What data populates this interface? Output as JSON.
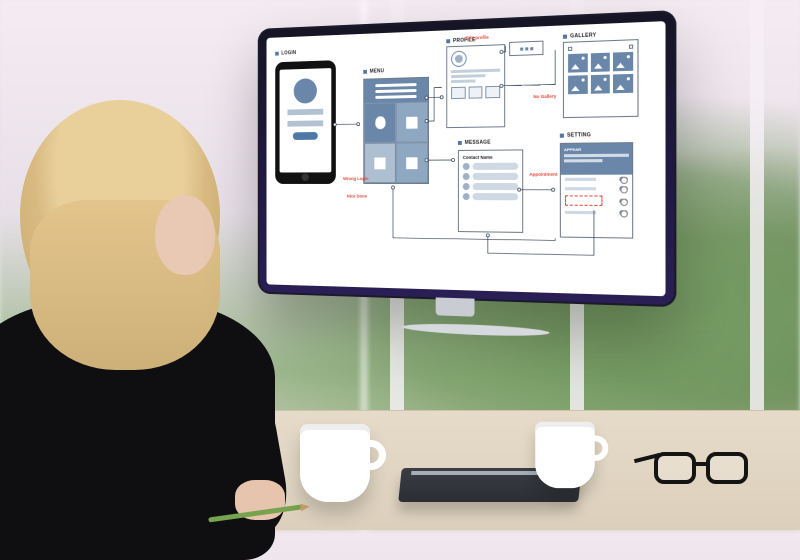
{
  "frames": {
    "login": {
      "label": "LOGIN"
    },
    "menu": {
      "label": "MENU"
    },
    "profile": {
      "label": "PROFILE"
    },
    "gallery": {
      "label": "GALLERY"
    },
    "message": {
      "label": "MESSAGE",
      "header": "Contact Name"
    },
    "setting": {
      "label": "SETTING",
      "section": "APPEAR"
    }
  },
  "annotations": {
    "edit_profile": "Edit profile",
    "no_gallery": "No Gallery",
    "wrong_login": "Wrong Login",
    "nice_done": "Nice Done",
    "appointment": "Appointment"
  }
}
